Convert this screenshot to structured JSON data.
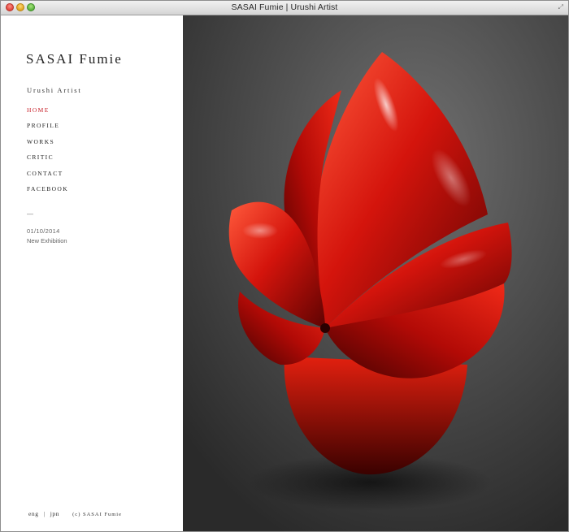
{
  "window": {
    "title": "SASAI Fumie | Urushi Artist"
  },
  "site": {
    "name": "SASAI Fumie",
    "subtitle": "Urushi Artist"
  },
  "nav": [
    {
      "label": "HOME",
      "active": true
    },
    {
      "label": "PROFILE"
    },
    {
      "label": "WORKS"
    },
    {
      "label": "CRITIC"
    },
    {
      "label": "CONTACT"
    },
    {
      "label": "FACEBOOK"
    }
  ],
  "news": {
    "separator": "—",
    "date": "01/10/2014",
    "title": "New Exhibition"
  },
  "footer": {
    "lang_en": "eng",
    "divider": "|",
    "lang_jp": "jpn",
    "copyright": "(c) SASAI Fumie"
  },
  "colors": {
    "accent": "#c8232c",
    "sculpture": "#d0140c",
    "background": "#4a4a4a"
  },
  "icons": {
    "close": "close-button",
    "minimize": "minimize-button",
    "zoom": "zoom-button",
    "fullscreen": "fullscreen-icon"
  }
}
